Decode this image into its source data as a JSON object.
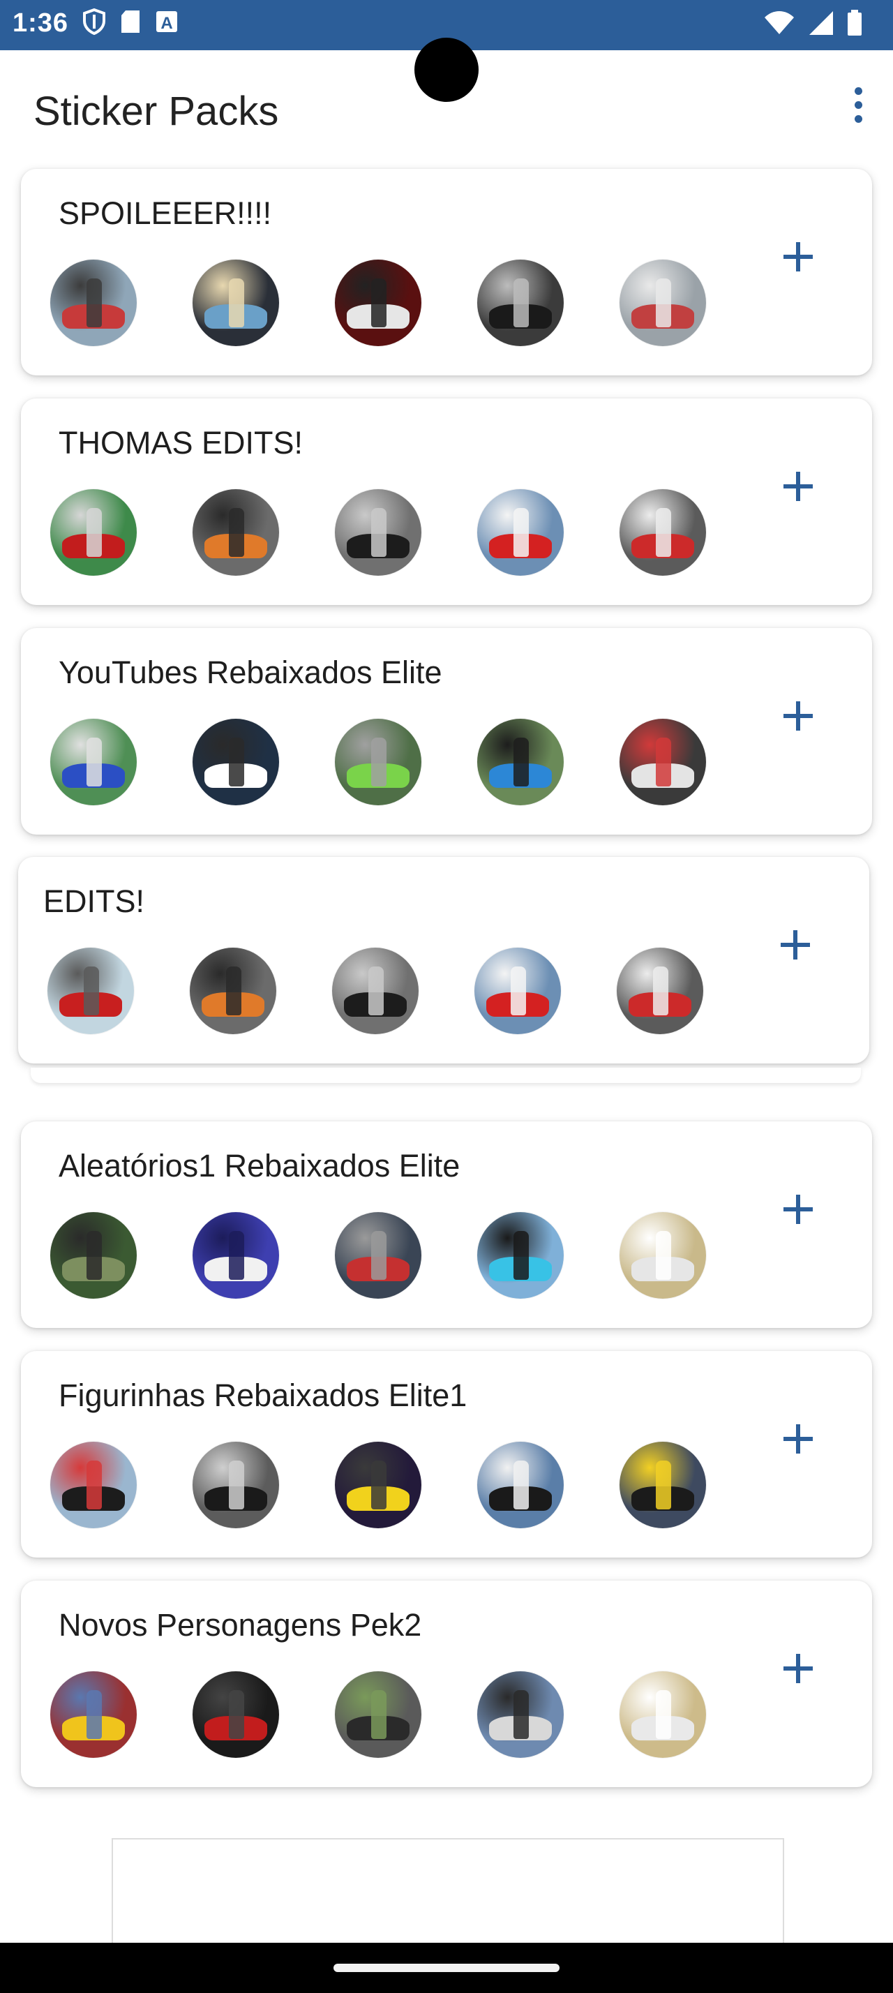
{
  "status_bar": {
    "time": "1:36",
    "left_icons": [
      "shield-icon",
      "sd-card-icon",
      "keyboard-a-icon"
    ],
    "right_icons": [
      "wifi-icon",
      "signal-icon",
      "battery-icon"
    ]
  },
  "app_bar": {
    "title": "Sticker Packs",
    "menu_icon": "overflow-menu-icon"
  },
  "colors": {
    "accent": "#2c5e99",
    "status_bar": "#2c5e99",
    "background": "#ffffff",
    "text": "#1e1e1e"
  },
  "packs": [
    {
      "title": "SPOILEEER!!!!",
      "stickers": 5,
      "add_icon": "plus-icon"
    },
    {
      "title": "THOMAS EDITS!",
      "stickers": 5,
      "add_icon": "plus-icon"
    },
    {
      "title": "YouTubes Rebaixados Elite",
      "stickers": 5,
      "add_icon": "plus-icon"
    },
    {
      "title": "EDITS!",
      "stickers": 5,
      "add_icon": "plus-icon"
    },
    {
      "title": "Aleatórios1 Rebaixados Elite",
      "stickers": 5,
      "add_icon": "plus-icon"
    },
    {
      "title": "Figurinhas Rebaixados Elite1",
      "stickers": 5,
      "add_icon": "plus-icon"
    },
    {
      "title": "Novos Personagens Pek2",
      "stickers": 5,
      "add_icon": "plus-icon"
    }
  ]
}
